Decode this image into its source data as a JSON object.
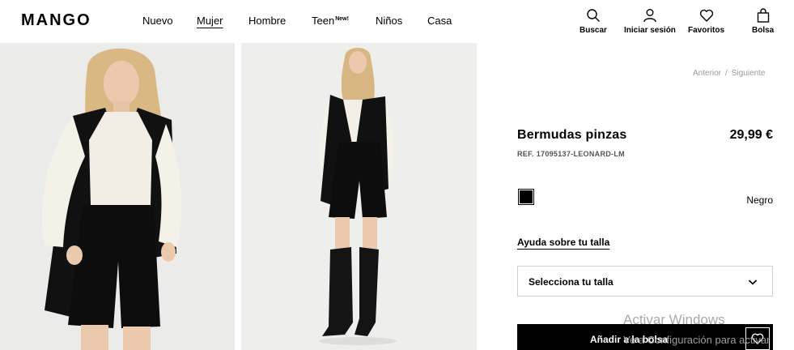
{
  "header": {
    "logo": "MANGO",
    "nav": [
      {
        "label": "Nuevo"
      },
      {
        "label": "Mujer"
      },
      {
        "label": "Hombre"
      },
      {
        "label": "Teen",
        "badge": "New!"
      },
      {
        "label": "Niños"
      },
      {
        "label": "Casa"
      }
    ],
    "actions": [
      {
        "label": "Buscar",
        "icon": "search-icon"
      },
      {
        "label": "Iniciar sesión",
        "icon": "user-icon"
      },
      {
        "label": "Favoritos",
        "icon": "heart-icon"
      },
      {
        "label": "Bolsa",
        "icon": "bag-icon"
      }
    ]
  },
  "product": {
    "previous": "Anterior",
    "separator": "/",
    "next": "Siguiente",
    "name": "Bermudas pinzas",
    "price": "29,99 €",
    "ref_prefix": "REF.",
    "ref": "17095137-LEONARD-LM",
    "color_name": "Negro",
    "swatch_color": "#000000",
    "size_help": "Ayuda sobre tu talla",
    "size_select": "Selecciona tu talla",
    "add_to_bag": "Añadir a la bolsa"
  },
  "watermark": {
    "title": "Activar Windows",
    "subtitle": "Ve a Configuración para activar"
  }
}
